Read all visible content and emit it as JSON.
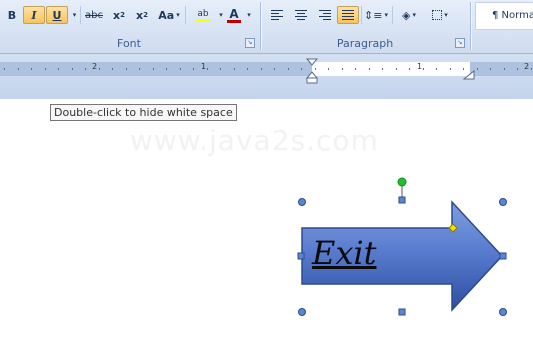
{
  "ribbon": {
    "font": {
      "label": "Font",
      "bold": "B",
      "italic": "I",
      "underline": "U",
      "strikethrough": "abc",
      "subscript": "x",
      "subscript_mark": "2",
      "superscript": "x",
      "superscript_mark": "2",
      "change_case": "Aa",
      "highlight": "ab",
      "font_color": "A"
    },
    "paragraph": {
      "label": "Paragraph"
    },
    "styles": {
      "normal": "¶ Norma"
    }
  },
  "ruler": {
    "left_number": "2",
    "mid_number": "1",
    "right_number_1": "1",
    "right_number_2": "2"
  },
  "document": {
    "tooltip": "Double-click to hide white space",
    "watermark": "www.java2s.com",
    "shape_text": "Exit"
  },
  "colors": {
    "ribbon_text": "#1e395b",
    "group_label": "#3e5e8c",
    "active_button": "#f9c35c",
    "arrow_fill": "#4a6fc7",
    "handle": "#5b86d6",
    "rotate_handle": "#1fbf2f",
    "adjust_handle": "#f5e000"
  }
}
